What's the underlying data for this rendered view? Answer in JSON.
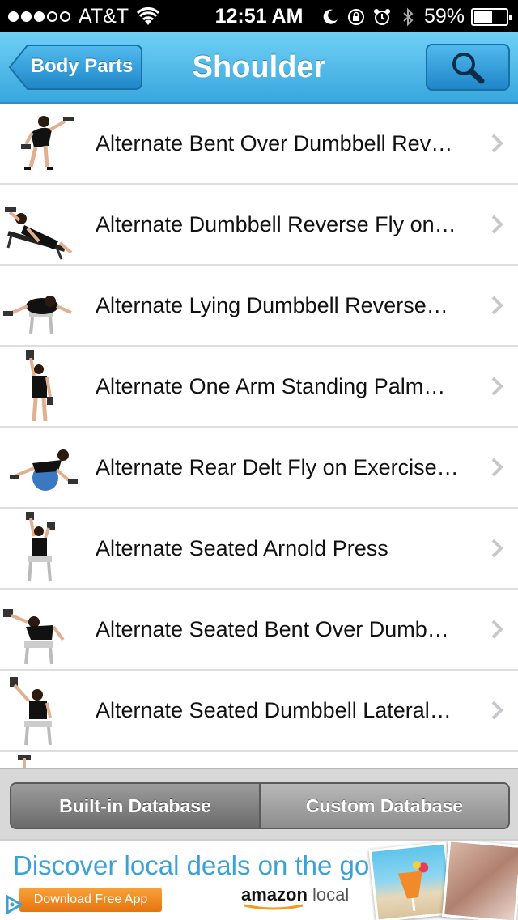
{
  "status_bar": {
    "carrier": "AT&T",
    "signal_bars_filled": 3,
    "signal_bars_total": 5,
    "time": "12:51 AM",
    "battery_percent": "59%",
    "battery_level": 0.59
  },
  "nav": {
    "back_label": "Body Parts",
    "title": "Shoulder",
    "search_icon": "search-icon",
    "colors": {
      "nav_top": "#6fd0f5",
      "nav_bottom": "#38a6de"
    }
  },
  "exercises": [
    {
      "label": "Alternate Bent Over Dumbbell Rev…"
    },
    {
      "label": "Alternate Dumbbell Reverse Fly on…"
    },
    {
      "label": "Alternate Lying Dumbbell Reverse…"
    },
    {
      "label": "Alternate One Arm Standing Palm…"
    },
    {
      "label": "Alternate Rear Delt Fly on Exercise…"
    },
    {
      "label": "Alternate Seated Arnold Press"
    },
    {
      "label": "Alternate Seated Bent Over Dumb…"
    },
    {
      "label": "Alternate Seated Dumbbell Lateral…"
    }
  ],
  "database_tabs": {
    "builtin": "Built-in Database",
    "custom": "Custom Database"
  },
  "ad": {
    "headline": "Discover local deals on the go",
    "cta": "Download Free App",
    "brand": "amazon",
    "brand_suffix": "local",
    "colors": {
      "headline": "#3aa2d8",
      "cta": "#e6730e"
    }
  }
}
